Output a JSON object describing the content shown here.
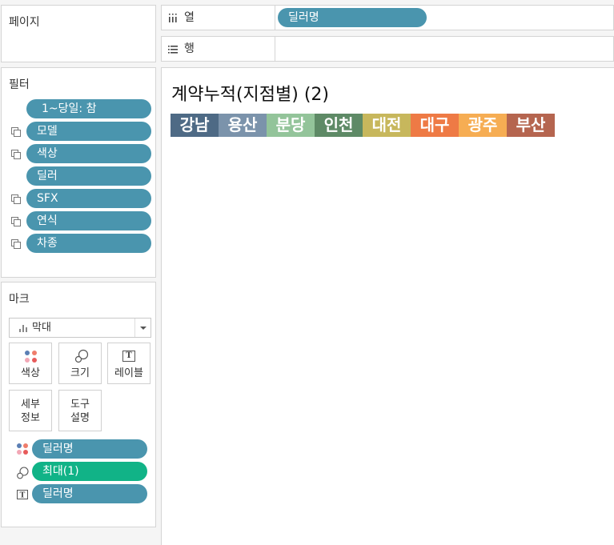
{
  "pages": {
    "title": "페이지"
  },
  "columns_shelf": {
    "label": "열",
    "icon": "columns-icon",
    "pill": "딜러명"
  },
  "rows_shelf": {
    "label": "행",
    "icon": "rows-icon"
  },
  "filters": {
    "title": "필터",
    "items": [
      {
        "label": "1~당일: 참",
        "icon": null
      },
      {
        "label": "모델",
        "icon": "context-filter-icon"
      },
      {
        "label": "색상",
        "icon": "context-filter-icon"
      },
      {
        "label": "딜러",
        "icon": null
      },
      {
        "label": "SFX",
        "icon": "context-filter-icon"
      },
      {
        "label": "연식",
        "icon": "context-filter-icon"
      },
      {
        "label": "차종",
        "icon": "context-filter-icon"
      }
    ]
  },
  "marks": {
    "title": "마크",
    "mark_type": "막대",
    "buttons": {
      "color": "색상",
      "size": "크기",
      "label": "레이블",
      "detail": "세부\n정보",
      "tooltip": "도구\n설명"
    },
    "fields": [
      {
        "label": "딜러명",
        "icon": "color-icon",
        "color": "#4a95ae"
      },
      {
        "label": "최대(1)",
        "icon": "size-icon",
        "color": "#11b387"
      },
      {
        "label": "딜러명",
        "icon": "text-icon",
        "color": "#4a95ae"
      }
    ]
  },
  "sheet": {
    "title": "계약누적(지점별) (2)",
    "legend": [
      {
        "label": "강남",
        "color": "#4e6a85"
      },
      {
        "label": "용산",
        "color": "#7b93ab"
      },
      {
        "label": "분당",
        "color": "#93c49a"
      },
      {
        "label": "인천",
        "color": "#5e8a66"
      },
      {
        "label": "대전",
        "color": "#c7b75c"
      },
      {
        "label": "대구",
        "color": "#ee7a45"
      },
      {
        "label": "광주",
        "color": "#f6ad53"
      },
      {
        "label": "부산",
        "color": "#b5654f"
      }
    ]
  }
}
